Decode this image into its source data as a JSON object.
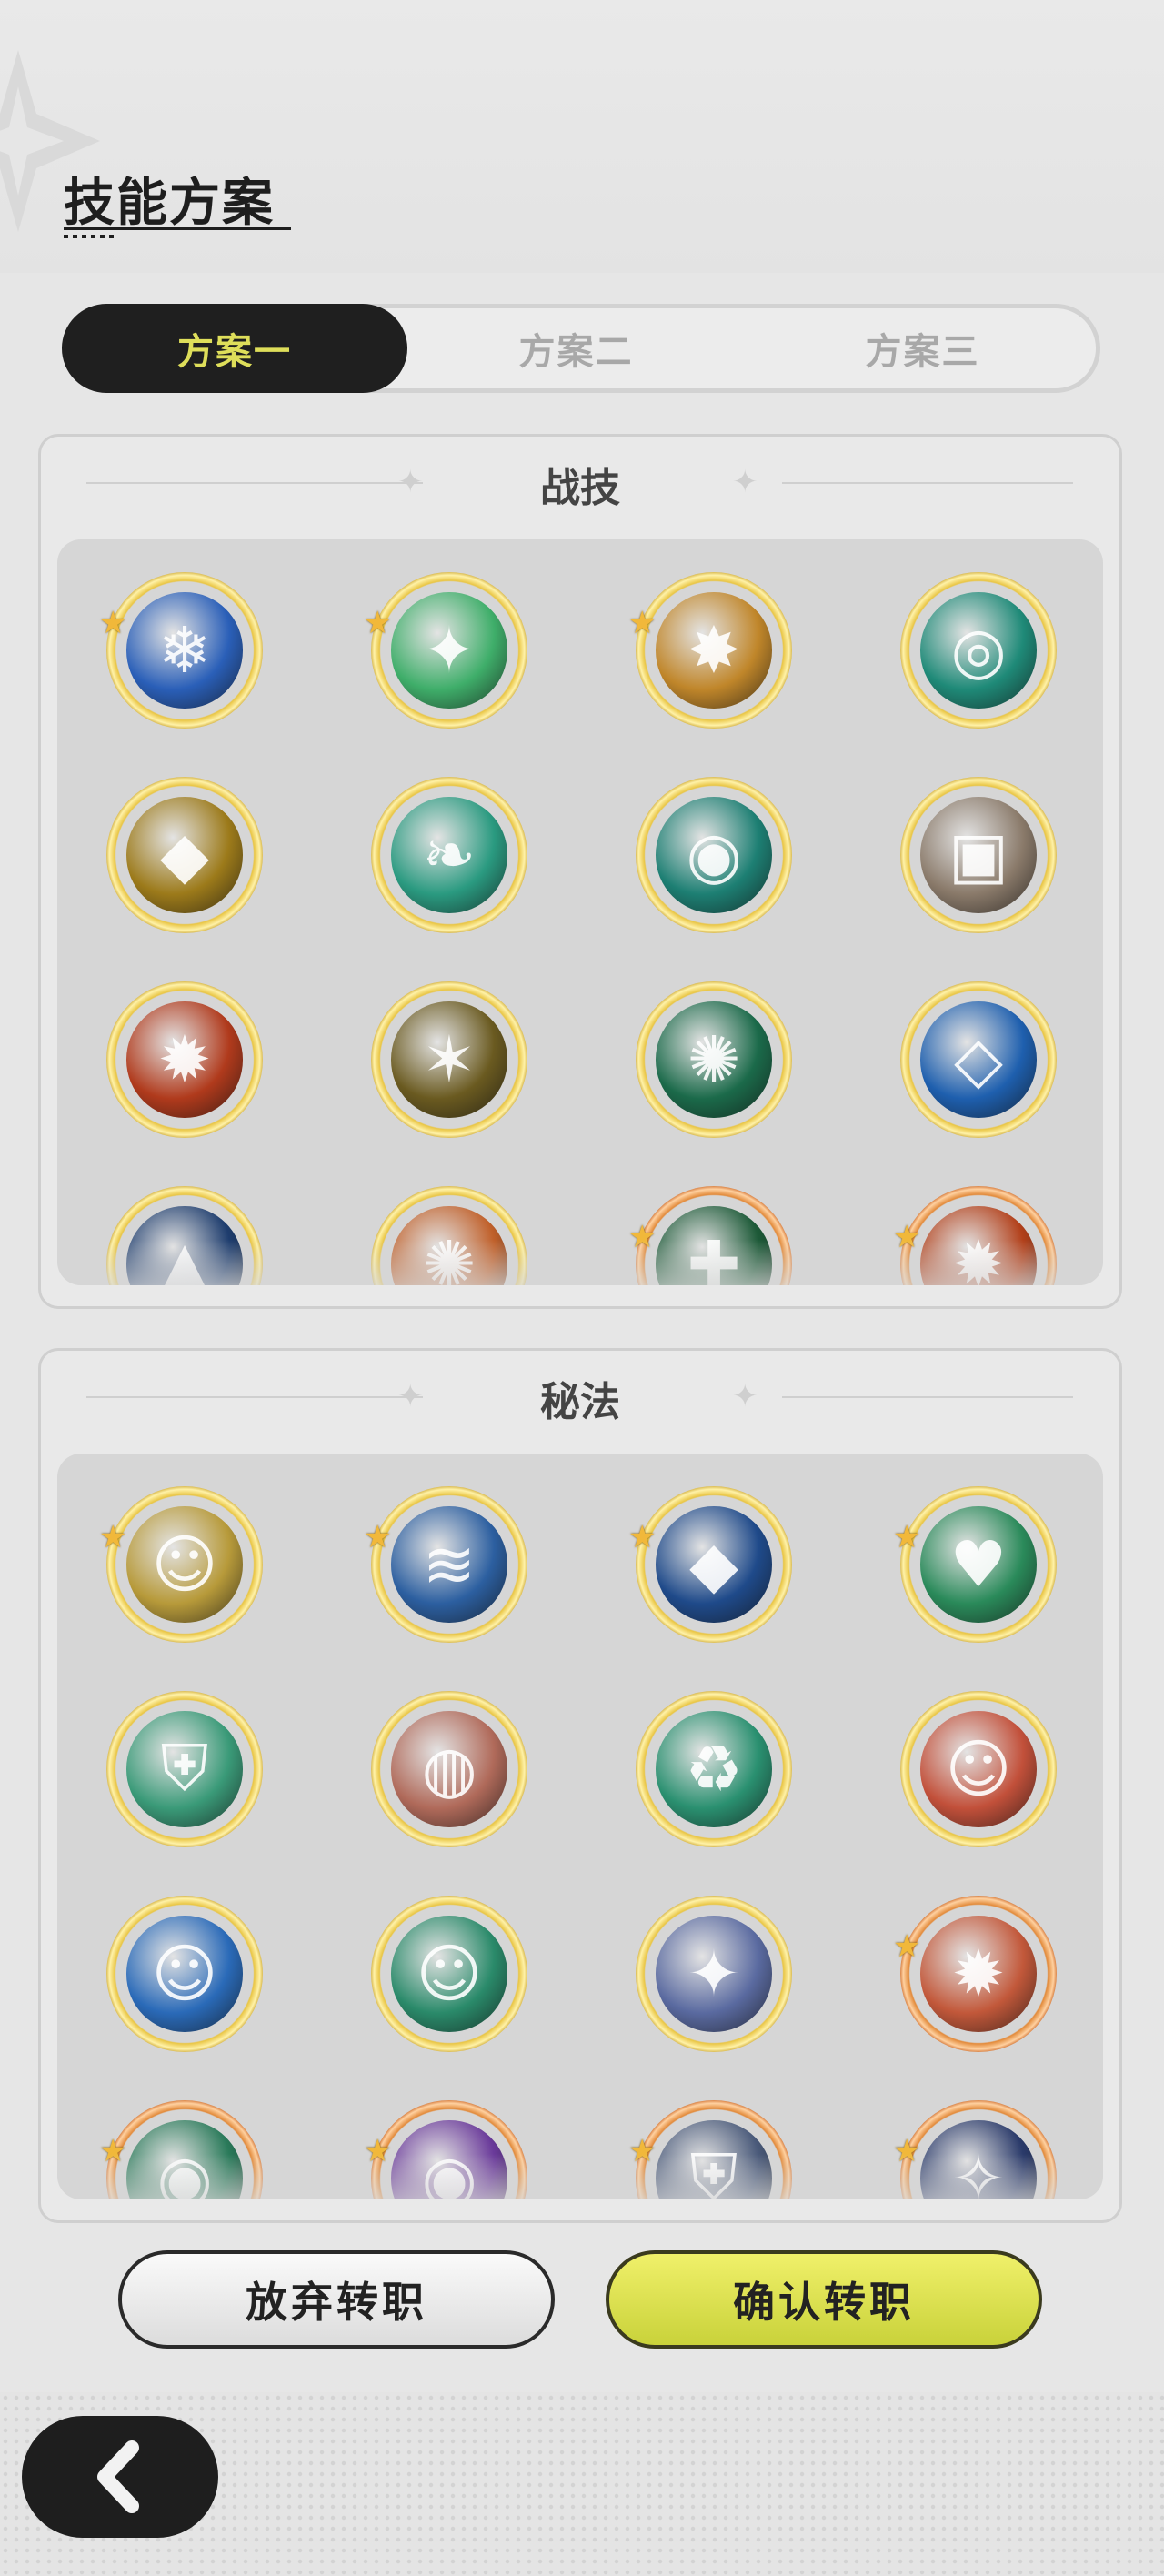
{
  "header": {
    "title": "技能方案"
  },
  "tabs": [
    {
      "label": "方案一",
      "active": true
    },
    {
      "label": "方案二",
      "active": false
    },
    {
      "label": "方案三",
      "active": false
    }
  ],
  "sections": {
    "combat": {
      "title": "战技",
      "skills": [
        {
          "icon": "ice-burst-icon",
          "starred": true,
          "tier": "gold",
          "color": "#2a5fb8",
          "glyph": "❄"
        },
        {
          "icon": "wind-swirl-icon",
          "starred": true,
          "tier": "gold",
          "color": "#3fae6a",
          "glyph": "✦"
        },
        {
          "icon": "light-strike-icon",
          "starred": true,
          "tier": "gold",
          "color": "#c0862a",
          "glyph": "✸"
        },
        {
          "icon": "green-orbit-icon",
          "starred": false,
          "tier": "gold",
          "color": "#1f8a78",
          "glyph": "◎"
        },
        {
          "icon": "golden-sigil-icon",
          "starred": false,
          "tier": "gold",
          "color": "#9c7a1a",
          "glyph": "◆"
        },
        {
          "icon": "leaf-blades-icon",
          "starred": false,
          "tier": "gold",
          "color": "#2a9a80",
          "glyph": "❧"
        },
        {
          "icon": "vortex-icon",
          "starred": false,
          "tier": "gold",
          "color": "#1d7f73",
          "glyph": "◉"
        },
        {
          "icon": "card-shield-icon",
          "starred": false,
          "tier": "gold",
          "color": "#8a7a6a",
          "glyph": "▣"
        },
        {
          "icon": "fireball-icon",
          "starred": false,
          "tier": "gold",
          "color": "#b03a1c",
          "glyph": "✹"
        },
        {
          "icon": "lightning-comet-icon",
          "starred": false,
          "tier": "gold",
          "color": "#6a5a20",
          "glyph": "✶"
        },
        {
          "icon": "thorn-ring-icon",
          "starred": false,
          "tier": "gold",
          "color": "#1b6a4a",
          "glyph": "✺"
        },
        {
          "icon": "ice-crystal-icon",
          "starred": false,
          "tier": "gold",
          "color": "#1e5fae",
          "glyph": "◇"
        },
        {
          "icon": "ice-spike-icon",
          "starred": false,
          "tier": "gold",
          "color": "#1e3d6e",
          "glyph": "▲"
        },
        {
          "icon": "fire-swirl-icon",
          "starred": false,
          "tier": "gold",
          "color": "#c0602a",
          "glyph": "✺"
        },
        {
          "icon": "heal-field-icon",
          "starred": true,
          "tier": "orange",
          "color": "#1d5a38",
          "glyph": "✚"
        },
        {
          "icon": "flame-burst-icon",
          "starred": true,
          "tier": "orange",
          "color": "#b2401a",
          "glyph": "✹"
        }
      ]
    },
    "arcane": {
      "title": "秘法",
      "skills": [
        {
          "icon": "light-figure-icon",
          "starred": true,
          "tier": "gold",
          "color": "#b79a3a",
          "glyph": "☺"
        },
        {
          "icon": "water-wave-icon",
          "starred": true,
          "tier": "gold",
          "color": "#2c5fa0",
          "glyph": "≋"
        },
        {
          "icon": "crystal-shard-icon",
          "starred": true,
          "tier": "gold",
          "color": "#1f4a8a",
          "glyph": "◆"
        },
        {
          "icon": "heart-icon",
          "starred": true,
          "tier": "gold",
          "color": "#2a8a5a",
          "glyph": "♥"
        },
        {
          "icon": "shield-icon",
          "starred": false,
          "tier": "gold",
          "color": "#3a9a78",
          "glyph": "⛨"
        },
        {
          "icon": "flesh-swirl-icon",
          "starred": false,
          "tier": "gold",
          "color": "#b06a5a",
          "glyph": "◍"
        },
        {
          "icon": "recycle-icon",
          "starred": false,
          "tier": "gold",
          "color": "#2a9070",
          "glyph": "♻"
        },
        {
          "icon": "fire-figure-icon",
          "starred": false,
          "tier": "gold",
          "color": "#c2503a",
          "glyph": "☺"
        },
        {
          "icon": "water-figure-icon",
          "starred": false,
          "tier": "gold",
          "color": "#2a6ab8",
          "glyph": "☺"
        },
        {
          "icon": "nature-figure-icon",
          "starred": false,
          "tier": "gold",
          "color": "#2a8a6a",
          "glyph": "☺"
        },
        {
          "icon": "star-crystal-icon",
          "starred": false,
          "tier": "gold",
          "color": "#5a6aa0",
          "glyph": "✦"
        },
        {
          "icon": "phoenix-icon",
          "starred": true,
          "tier": "orange",
          "color": "#c2583a",
          "glyph": "✹"
        },
        {
          "icon": "green-orb-icon",
          "starred": true,
          "tier": "orange",
          "color": "#2a7a5a",
          "glyph": "◉"
        },
        {
          "icon": "purple-orb-icon",
          "starred": true,
          "tier": "orange",
          "color": "#6a3a9a",
          "glyph": "◉"
        },
        {
          "icon": "armor-icon",
          "starred": true,
          "tier": "orange",
          "color": "#4a5a7a",
          "glyph": "⛨"
        },
        {
          "icon": "starry-night-icon",
          "starred": true,
          "tier": "orange",
          "color": "#2a3a6a",
          "glyph": "✧"
        }
      ]
    }
  },
  "buttons": {
    "cancel": "放弃转职",
    "confirm": "确认转职"
  }
}
